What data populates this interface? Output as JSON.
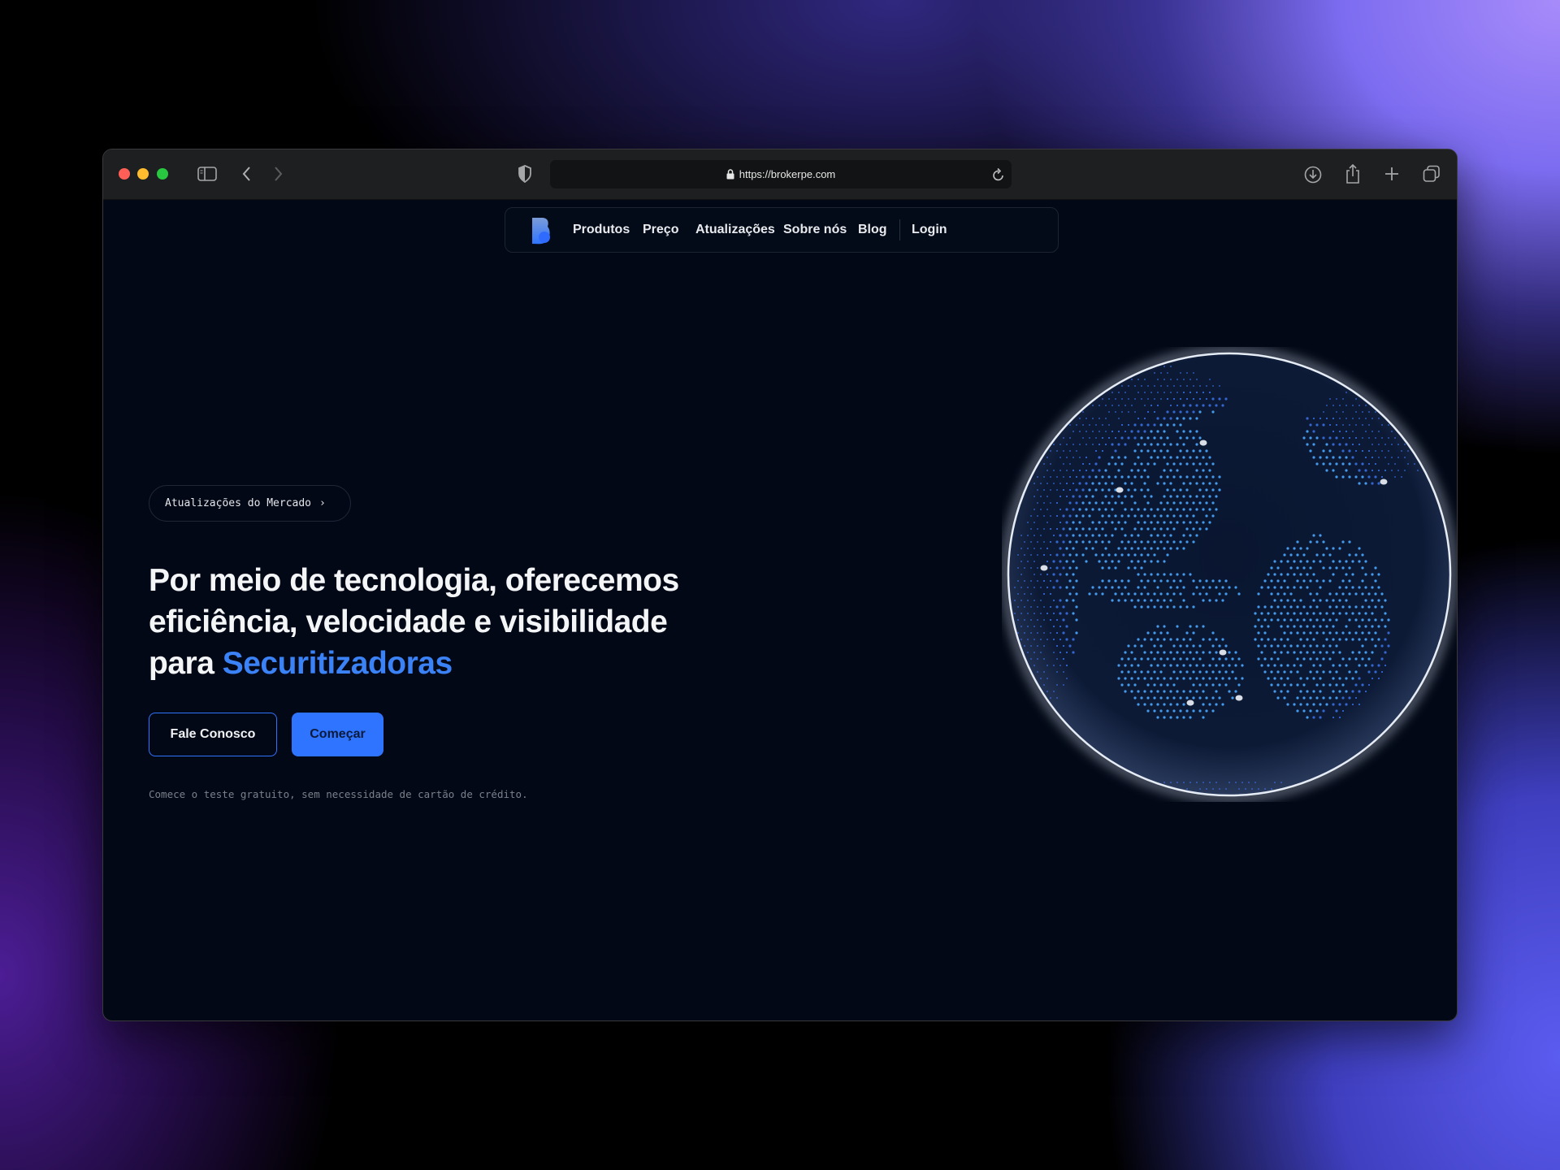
{
  "browser": {
    "url": "https://brokerpe.com",
    "traffic_lights": [
      "#ff5f57",
      "#febc2e",
      "#28c840"
    ]
  },
  "nav": {
    "items": [
      "Produtos",
      "Preço",
      "Atualizações",
      "Sobre nós",
      "Blog"
    ],
    "login": "Login"
  },
  "hero": {
    "badge": "Atualizações do Mercado",
    "badge_chevron": "›",
    "headline_line1": "Por meio de tecnologia, oferecemos",
    "headline_line2": "eficiência, velocidade e visibilidade",
    "headline_line3_prefix": "para ",
    "headline_accent": "Securitizadoras",
    "contact_button": "Fale Conosco",
    "start_button": "Começar",
    "footnote": "Comece o teste gratuito, sem necessidade de cartão de crédito."
  },
  "colors": {
    "accent": "#3b82f6",
    "primary_button": "#2f74ff",
    "background": "#020816"
  }
}
